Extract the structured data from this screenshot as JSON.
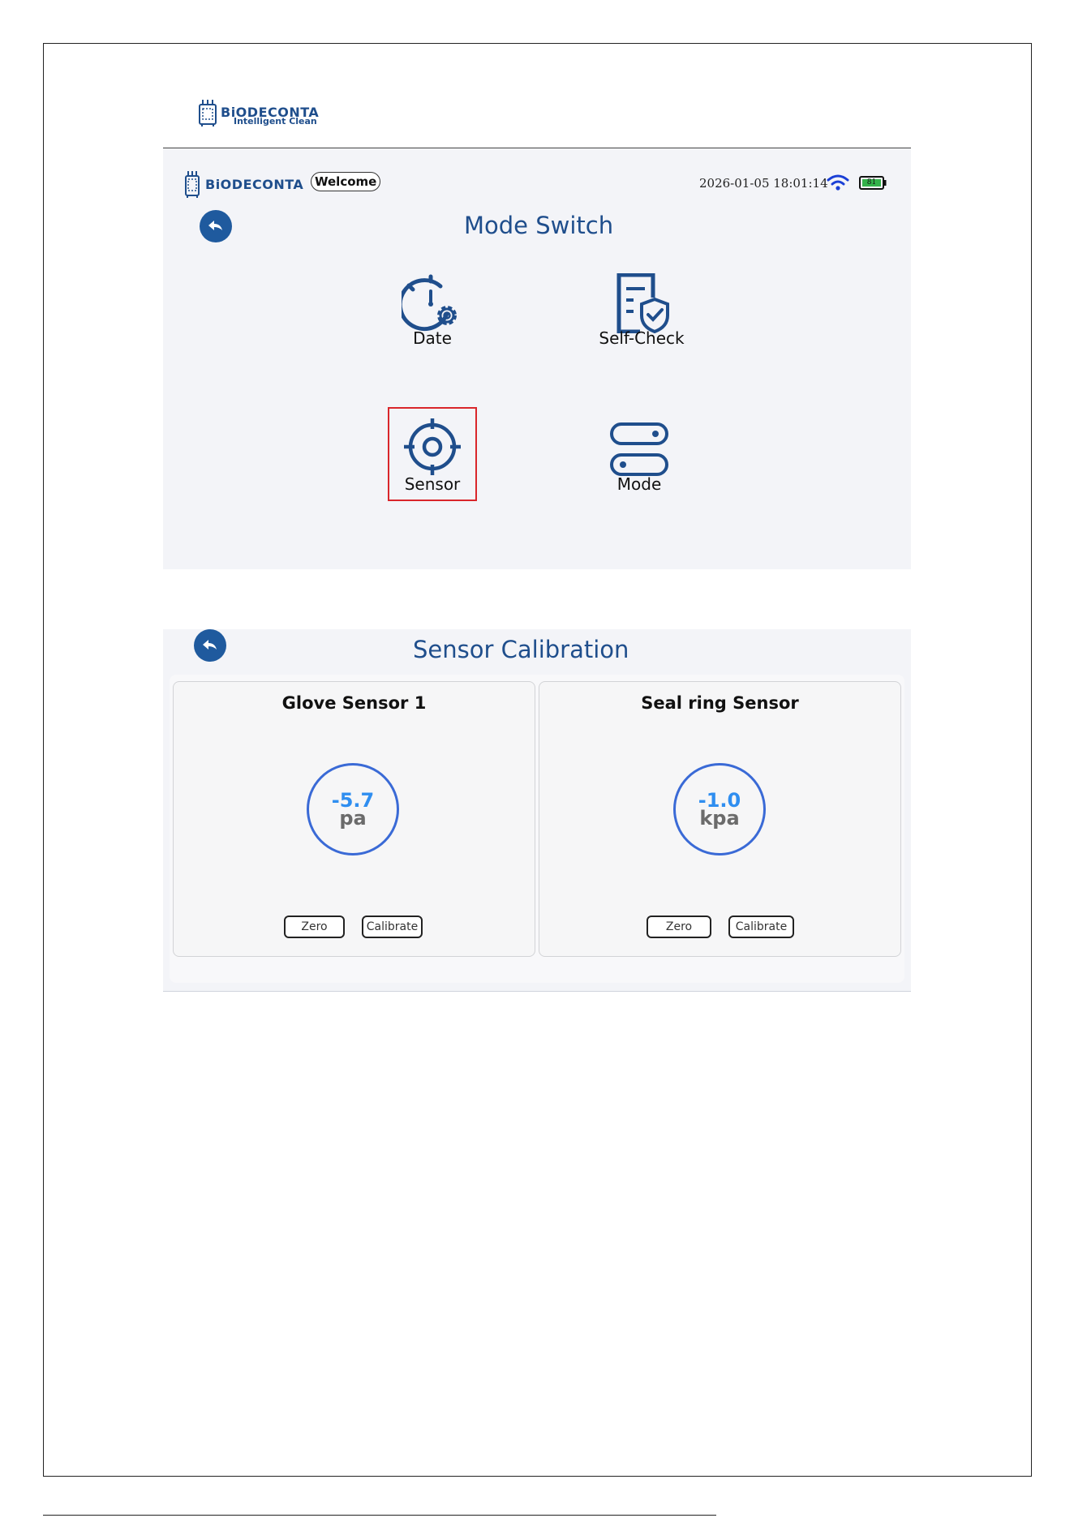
{
  "document": {
    "logo": {
      "brand": "BiODECONTA",
      "tagline": "Intelligent Clean"
    }
  },
  "mode_switch_screen": {
    "header": {
      "brand": "BiODECONTA",
      "welcome": "Welcome",
      "datetime": "2026-01-05 18:01:14",
      "battery_level": "81"
    },
    "title": "Mode Switch",
    "tiles": [
      {
        "label": "Date",
        "icon": "clock-gear-icon"
      },
      {
        "label": "Self-Check",
        "icon": "document-shield-icon"
      },
      {
        "label": "Sensor",
        "icon": "crosshair-icon",
        "highlighted": true
      },
      {
        "label": "Mode",
        "icon": "toggle-switches-icon"
      }
    ],
    "highlight_color": "#d9262b"
  },
  "sensor_screen": {
    "title": "Sensor Calibration",
    "sensors": [
      {
        "name": "Glove Sensor 1",
        "value": "-5.7",
        "unit": "pa",
        "zero_label": "Zero",
        "calibrate_label": "Calibrate"
      },
      {
        "name": "Seal ring Sensor",
        "value": "-1.0",
        "unit": "kpa",
        "zero_label": "Zero",
        "calibrate_label": "Calibrate"
      }
    ]
  },
  "colors": {
    "brand_blue": "#1f4e8c",
    "gauge_ring": "#3a6ad6",
    "gauge_value": "#2f8ef0"
  }
}
